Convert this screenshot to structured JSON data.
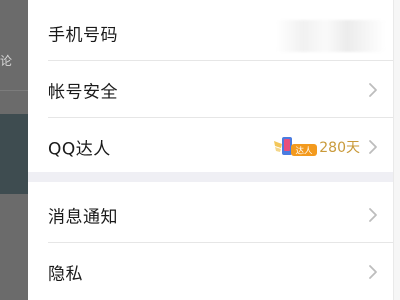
{
  "background": {
    "partial_text": "论"
  },
  "settings": {
    "account_group": [
      {
        "label": "手机号码",
        "value": "",
        "value_blurred": true
      },
      {
        "label": "帐号安全"
      },
      {
        "label": "QQ达人",
        "badge_text": "达人",
        "days": "280天"
      }
    ],
    "other_group": [
      {
        "label": "消息通知"
      },
      {
        "label": "隐私"
      }
    ]
  },
  "icons": {
    "chevron": "chevron-right-icon",
    "badge": "qq-talent-badge-icon"
  },
  "colors": {
    "panel_bg": "#efeff4",
    "card_bg": "#ffffff",
    "text": "#1a1a1a",
    "chevron": "#bdbdbd",
    "talent_gold": "#c99a3a",
    "badge_orange": "#f39a1e",
    "badge_blue": "#4a7be0"
  }
}
